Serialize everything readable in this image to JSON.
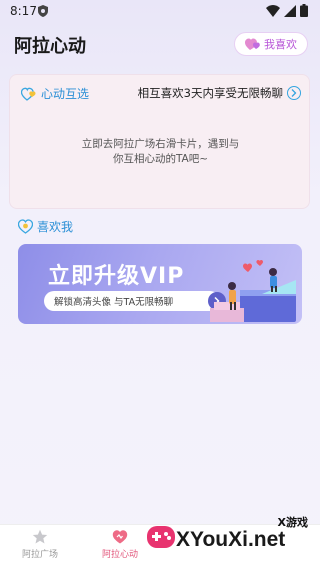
{
  "status_bar": {
    "time": "8:17"
  },
  "header": {
    "title": "阿拉心动",
    "like_button": "我喜欢"
  },
  "mutual": {
    "title": "心动互选",
    "tip": "相互喜欢3天内享受无限畅聊",
    "empty_line1": "立即去阿拉广场右滑卡片，遇到与",
    "empty_line2": "你互相心动的TA吧~"
  },
  "liked_me": {
    "title": "喜欢我"
  },
  "vip": {
    "title": "立即升级VIP",
    "subtitle": "解锁高清头像  与TA无限畅聊"
  },
  "bottom_nav": {
    "items": [
      {
        "label": "阿拉广场",
        "icon": "star-icon"
      },
      {
        "label": "阿拉心动",
        "icon": "heart-icon"
      }
    ]
  },
  "watermark": {
    "top": "X游戏",
    "bottom": "XYouXi.net"
  },
  "colors": {
    "accent_blue": "#2a8fd6",
    "accent_pink": "#e2577c",
    "vip_purple": "#8e8ee8"
  }
}
